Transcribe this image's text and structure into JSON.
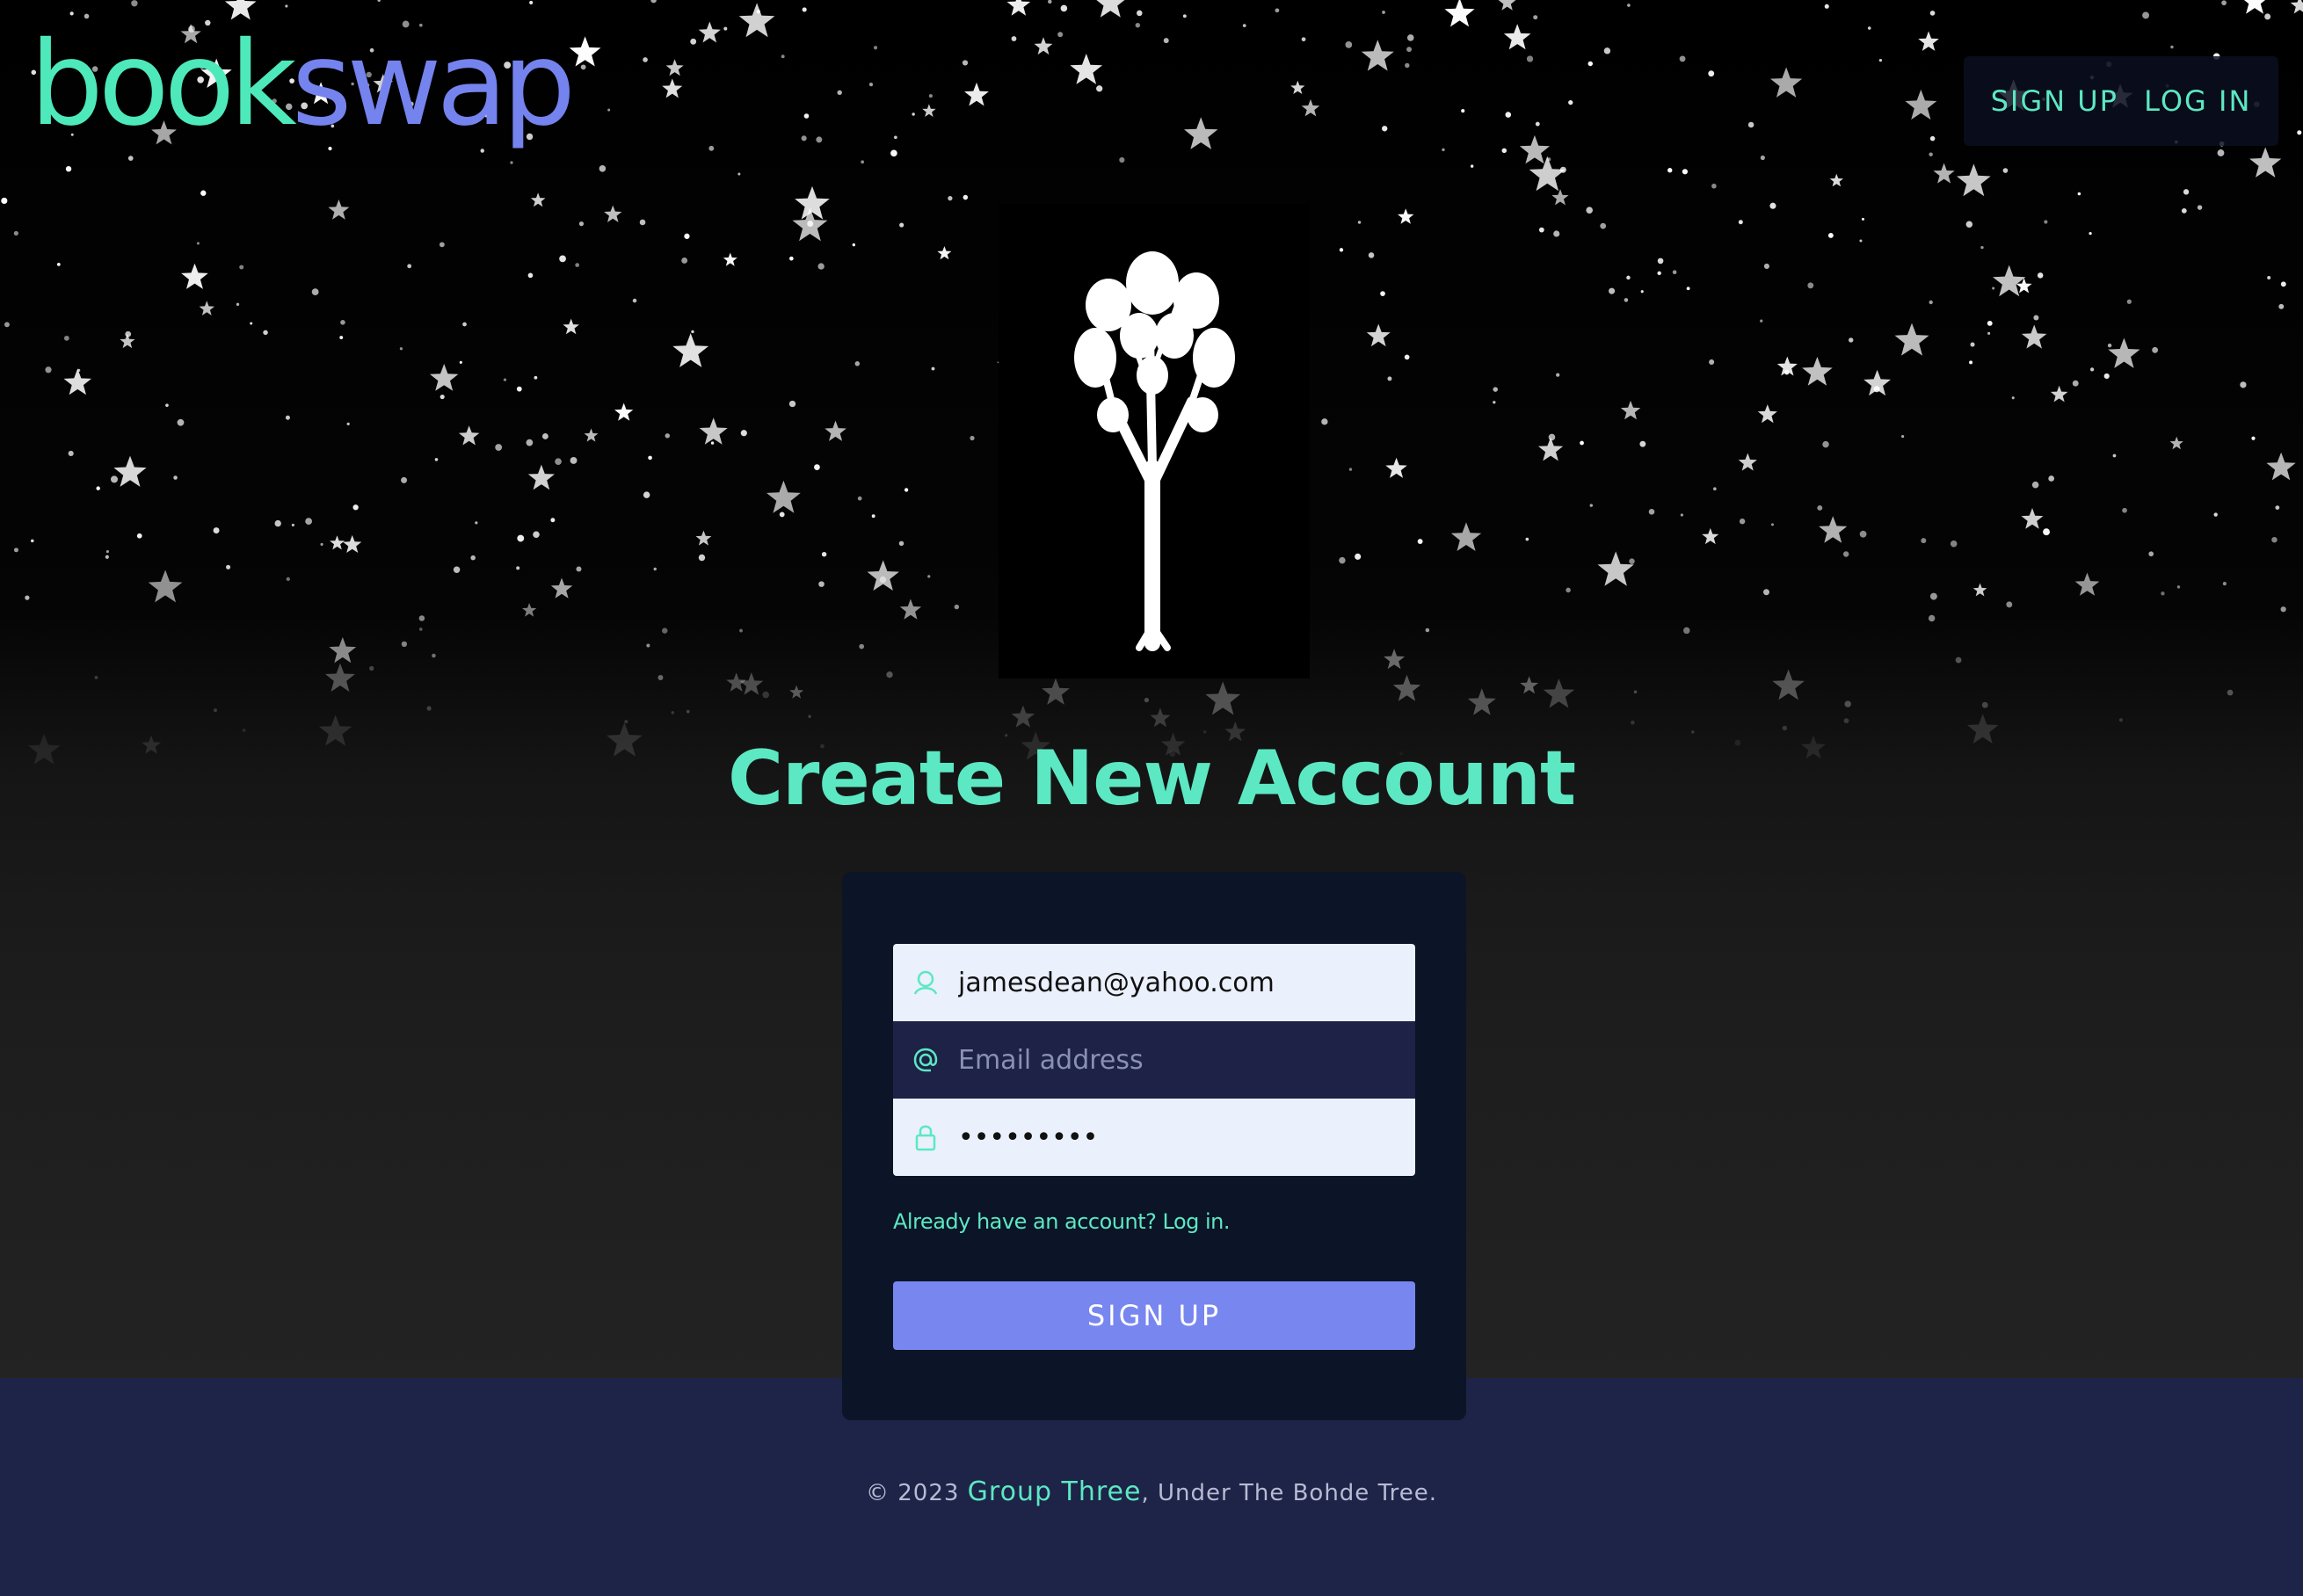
{
  "brand": {
    "part1": "book",
    "part2": "swap",
    "color1": "#4ee9bb",
    "color2": "#7583ee"
  },
  "nav": {
    "signup_label": "SIGN UP",
    "login_label": "LOG IN"
  },
  "hero": {
    "image": "tree-illustration"
  },
  "form": {
    "title": "Create New Account",
    "username": {
      "value": "jamesdean@yahoo.com",
      "icon": "user-icon"
    },
    "email": {
      "value": "",
      "placeholder": "Email address",
      "icon": "at-icon"
    },
    "password": {
      "value": "•••••••••",
      "icon": "lock-icon"
    },
    "login_link": "Already have an account? Log in.",
    "submit_label": "SIGN UP"
  },
  "footer": {
    "prefix": "© 2023 ",
    "org": "Group Three",
    "suffix": ", Under The Bohde Tree."
  },
  "colors": {
    "accent": "#5ce8c2",
    "button": "#7886ef",
    "card": "#0c1427",
    "footer": "#1e2348"
  }
}
